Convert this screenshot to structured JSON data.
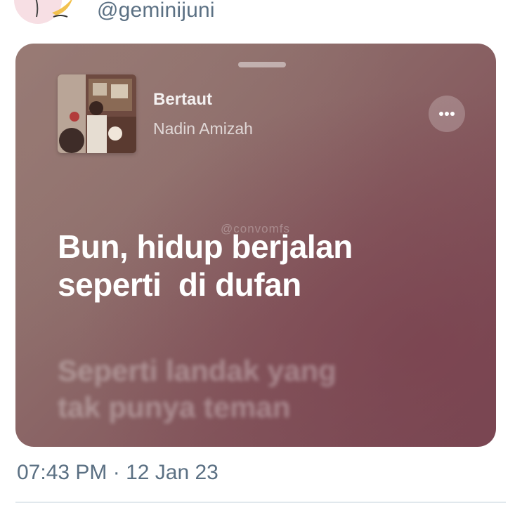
{
  "tweet": {
    "handle": "@geminijuni",
    "timestamp": "07:43 PM · 12 Jan 23"
  },
  "music_card": {
    "song_title": "Bertaut",
    "artist": "Nadin Amizah",
    "watermark": "@convomfs",
    "current_lyric": [
      "Bun, hidup berjalan",
      "seperti  di dufan"
    ],
    "next_lyric": [
      "Seperti landak yang",
      "tak punya teman"
    ],
    "more_icon": "ellipsis-icon"
  }
}
